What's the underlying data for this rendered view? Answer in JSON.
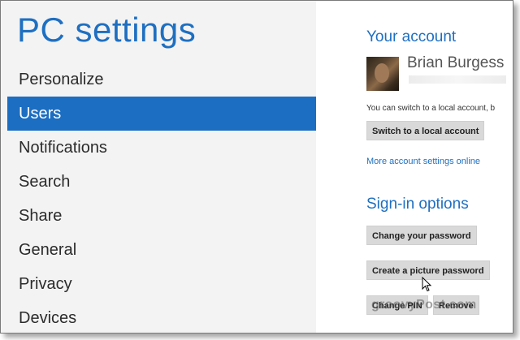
{
  "app": {
    "title": "PC settings"
  },
  "nav": {
    "items": [
      {
        "label": "Personalize"
      },
      {
        "label": "Users"
      },
      {
        "label": "Notifications"
      },
      {
        "label": "Search"
      },
      {
        "label": "Share"
      },
      {
        "label": "General"
      },
      {
        "label": "Privacy"
      },
      {
        "label": "Devices"
      }
    ],
    "selected": "Users"
  },
  "account": {
    "section_title": "Your account",
    "user_name": "Brian Burgess",
    "info_text": "You can switch to a local account, b",
    "switch_button": "Switch to a local account",
    "more_link": "More account settings online"
  },
  "signin": {
    "section_title": "Sign-in options",
    "change_password_button": "Change your password",
    "picture_password_button": "Create a picture password",
    "change_pin_button": "Change PIN",
    "remove_button": "Remove"
  },
  "watermark": {
    "text": "groovyPost.com"
  },
  "colors": {
    "accent": "#1b6ec2",
    "left_bg": "#f3f3f3",
    "button_bg": "#d9d9d9"
  }
}
